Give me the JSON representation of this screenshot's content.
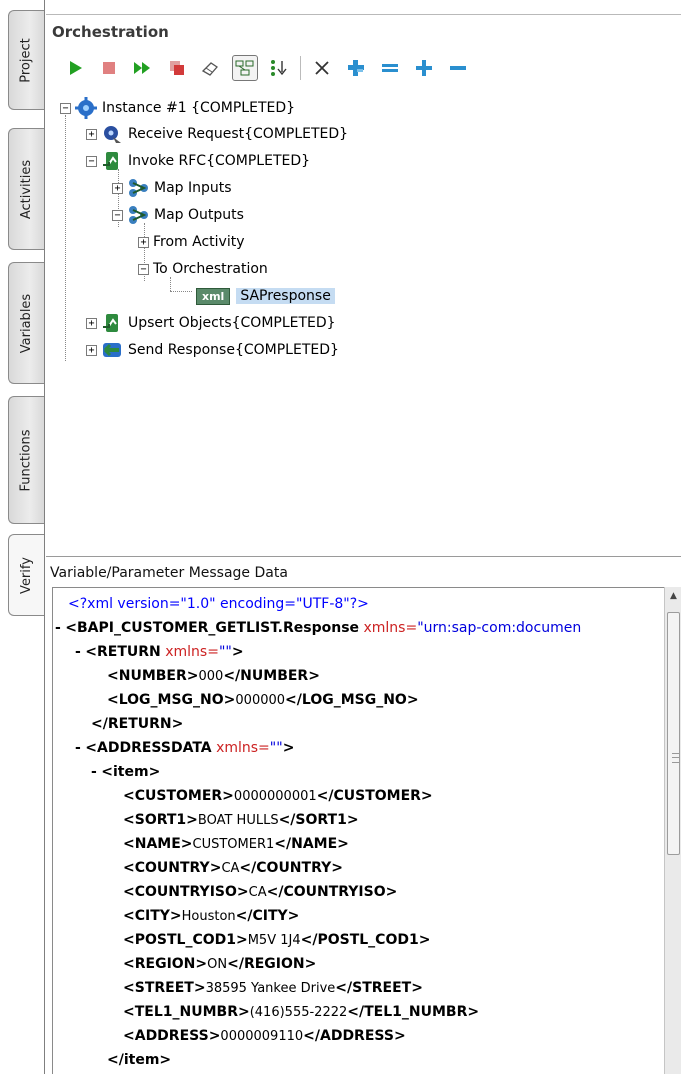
{
  "side_tabs": {
    "project": "Project",
    "activities": "Activities",
    "variables": "Variables",
    "functions": "Functions",
    "verify": "Verify"
  },
  "orchestration": {
    "title": "Orchestration",
    "toolbar_icons": [
      "run-icon",
      "stop-icon",
      "fast-forward-icon",
      "copy-icon",
      "eraser-icon",
      "layout-toggle-icon",
      "step-into-icon",
      "delete-icon",
      "collapse-icon",
      "remove-icon",
      "add-icon",
      "minus-icon"
    ],
    "tree": {
      "instance": "Instance #1 {COMPLETED}",
      "receive_request": "Receive Request{COMPLETED}",
      "invoke_rfc": "Invoke RFC{COMPLETED}",
      "map_inputs": "Map Inputs",
      "map_outputs": "Map Outputs",
      "from_activity": "From Activity",
      "to_orchestration": "To Orchestration",
      "xml_badge": "xml",
      "sap_response": "SAPresponse",
      "upsert_objects": "Upsert Objects{COMPLETED}",
      "send_response": "Send Response{COMPLETED}"
    }
  },
  "message_panel": {
    "title": "Variable/Parameter Message Data",
    "xml": {
      "decl": "<?xml version=\"1.0\" encoding=\"UTF-8\"?>",
      "dash": "-",
      "root_open": "<BAPI_CUSTOMER_GETLIST.Response",
      "root_attr": "xmlns=",
      "root_attr_val": "\"urn:sap-com:documen",
      "return_open": "<RETURN",
      "xmlns": "xmlns=",
      "empty_val": "\"\"",
      "gt": ">",
      "number_open": "<NUMBER>",
      "number_val": "000",
      "number_close": "</NUMBER>",
      "logmsg_open": "<LOG_MSG_NO>",
      "logmsg_val": "000000",
      "logmsg_close": "</LOG_MSG_NO>",
      "return_close": "</RETURN>",
      "addressdata_open": "<ADDRESSDATA",
      "item_open": "<item>",
      "fields": [
        {
          "open": "<CUSTOMER>",
          "val": "0000000001",
          "close": "</CUSTOMER>"
        },
        {
          "open": "<SORT1>",
          "val": "BOAT HULLS",
          "close": "</SORT1>"
        },
        {
          "open": "<NAME>",
          "val": "CUSTOMER1",
          "close": "</NAME>"
        },
        {
          "open": "<COUNTRY>",
          "val": "CA",
          "close": "</COUNTRY>"
        },
        {
          "open": "<COUNTRYISO>",
          "val": "CA",
          "close": "</COUNTRYISO>"
        },
        {
          "open": "<CITY>",
          "val": "Houston",
          "close": "</CITY>"
        },
        {
          "open": "<POSTL_COD1>",
          "val": "M5V 1J4",
          "close": "</POSTL_COD1>"
        },
        {
          "open": "<REGION>",
          "val": "ON",
          "close": "</REGION>"
        },
        {
          "open": "<STREET>",
          "val": "38595 Yankee Drive",
          "close": "</STREET>"
        },
        {
          "open": "<TEL1_NUMBR>",
          "val": "(416)555-2222",
          "close": "</TEL1_NUMBR>"
        },
        {
          "open": "<ADDRESS>",
          "val": "0000009110",
          "close": "</ADDRESS>"
        }
      ],
      "item_close": "</item>"
    }
  },
  "colors": {
    "selection": "#c5dcf2",
    "xml_pi": "#0000ff",
    "xml_attr": "#cc2222",
    "run_green": "#22a022",
    "stop_red": "#d23a3a"
  }
}
